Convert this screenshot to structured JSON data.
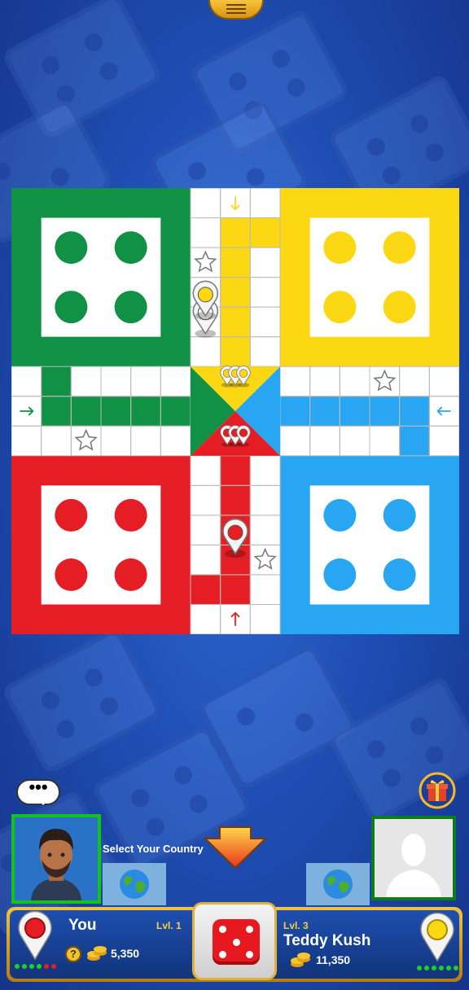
{
  "colors": {
    "green": "#109146",
    "yellow": "#fbd714",
    "blue": "#29a6f1",
    "red": "#e51e25"
  },
  "board": {
    "home_pieces": {
      "green": 4,
      "yellow": 4,
      "red": 4,
      "blue": 4
    },
    "tokens_on_board": [
      {
        "color": "yellow",
        "stacked": 2,
        "location": "yellow home column"
      },
      {
        "color": "red",
        "stacked": 1,
        "location": "red home column"
      }
    ],
    "center_stacks": {
      "yellow": 3,
      "red": 3
    },
    "safe_star_icons": 4,
    "arrow_icons": [
      "arrow-down",
      "arrow-right",
      "arrow-left",
      "arrow-up"
    ]
  },
  "chat": {
    "text": "•••"
  },
  "select_country": {
    "label": "Select Your Country"
  },
  "left_player": {
    "name": "You",
    "level": "Lvl. 1",
    "coins": "5,350",
    "piece_color": "red",
    "lives": [
      "green",
      "green",
      "green",
      "green",
      "red",
      "red"
    ]
  },
  "right_player": {
    "name": "Teddy Kush",
    "level": "Lvl. 3",
    "coins": "11,350",
    "piece_color": "yellow",
    "lives": [
      "green",
      "green",
      "green",
      "green",
      "green",
      "green"
    ]
  },
  "dice": {
    "value": 5
  },
  "help_icon": "?"
}
